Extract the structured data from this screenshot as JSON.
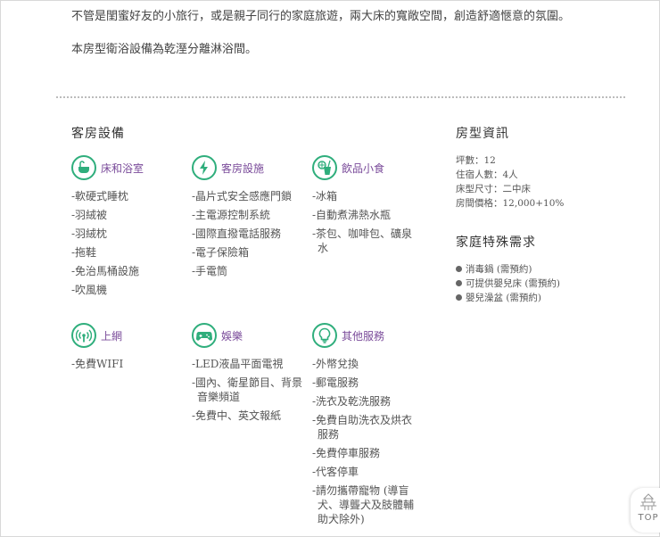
{
  "intro": {
    "line1": "不管是閨蜜好友的小旅行，或是親子同行的家庭旅遊，兩大床的寬敞空間，創造舒適愜意的氛圍。",
    "line2": "本房型衛浴設備為乾溼分離淋浴間。"
  },
  "amenities": {
    "title": "客房設備",
    "categories": [
      {
        "label": "床和浴室",
        "icon": "bathtub-icon",
        "items": [
          "-軟硬式睡枕",
          "-羽絨被",
          "-羽絨枕",
          "-拖鞋",
          "-免治馬桶設施",
          "-吹風機"
        ]
      },
      {
        "label": "客房設施",
        "icon": "lightning-icon",
        "items": [
          "-晶片式安全感應門鎖",
          "-主電源控制系統",
          "-國際直撥電話服務",
          "-電子保險箱",
          "-手電筒"
        ]
      },
      {
        "label": "飲品小食",
        "icon": "drink-icon",
        "items": [
          "-冰箱",
          "-自動煮沸熱水瓶",
          "-茶包、咖啡包、礦泉水"
        ]
      },
      {
        "label": "上網",
        "icon": "wifi-icon",
        "items": [
          "-免費WIFI"
        ]
      },
      {
        "label": "娛樂",
        "icon": "gamepad-icon",
        "items": [
          "-LED液晶平面電視",
          "-國內、衛星節目、背景音樂頻道",
          "-免費中、英文報紙"
        ]
      },
      {
        "label": "其他服務",
        "icon": "lightbulb-icon",
        "items": [
          "-外幣兌換",
          "-郵電服務",
          "-洗衣及乾洗服務",
          "-免費自助洗衣及烘衣服務",
          "-免費停車服務",
          "-代客停車",
          "-請勿攜帶寵物 (導盲犬、導聾犬及肢體輔助犬除外)"
        ]
      }
    ]
  },
  "room_info": {
    "title": "房型資訊",
    "lines": [
      "坪數：12",
      "住宿人數：4人",
      "床型尺寸：二中床",
      "房間價格：12,000+10%"
    ]
  },
  "family_needs": {
    "title": "家庭特殊需求",
    "items": [
      "消毒鍋 (需預約)",
      "可提供嬰兒床 (需預約)",
      "嬰兒澡盆 (需預約)"
    ]
  },
  "top_button": {
    "label": "TOP"
  },
  "colors": {
    "icon_green": "#2fae7c",
    "label_purple": "#7a4b9a"
  }
}
